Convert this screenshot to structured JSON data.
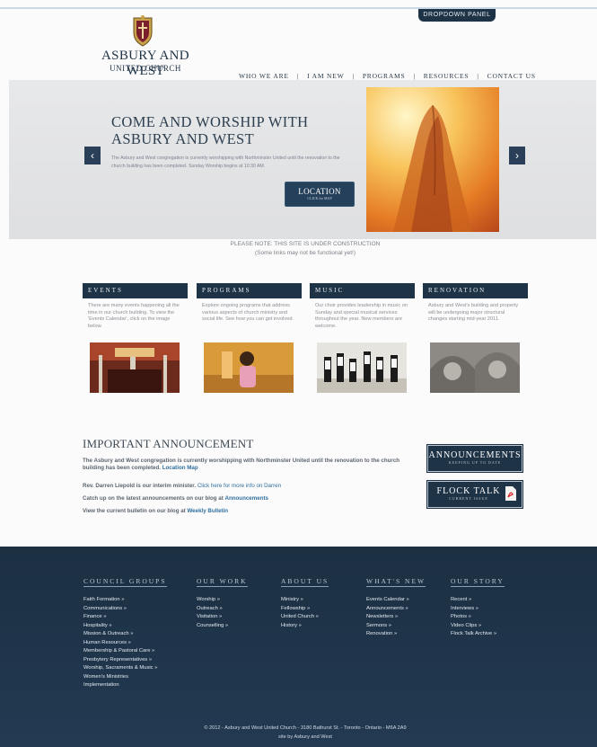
{
  "header": {
    "dropdown_label": "DROPDOWN PANEL",
    "logo_title": "ASBURY AND WEST",
    "logo_subtitle": "UNITED CHURCH"
  },
  "nav": [
    {
      "label": "WHO WE ARE"
    },
    {
      "label": "I AM NEW"
    },
    {
      "label": "PROGRAMS"
    },
    {
      "label": "RESOURCES"
    },
    {
      "label": "CONTACT US"
    }
  ],
  "hero": {
    "title_line1": "COME AND WORSHIP WITH",
    "title_line2": "ASBURY AND WEST",
    "text": "The Asbury and West congregation is currently worshipping with Northminster United until the renovation to the church building has been completed. Sunday Worship begins at 10:30 AM.",
    "button_label": "LOCATION",
    "button_sub": "CLICK for MAP",
    "prev_icon": "‹",
    "next_icon": "›"
  },
  "notice": {
    "line1": "PLEASE NOTE: THIS SITE IS UNDER CONSTRUCTION",
    "line2": "(Some links may not be functional yet!)"
  },
  "cards": [
    {
      "title": "EVENTS",
      "text": "There are many events happening all the time in our church building. To view the 'Events Calendar', click on the image below."
    },
    {
      "title": "PROGRAMS",
      "text": "Explore ongoing programs that address various aspects of church ministry and social life. See how you can get involved."
    },
    {
      "title": "MUSIC",
      "text": "Our choir provides leadership in music on Sunday and special musical services throughout the year. New members are welcome."
    },
    {
      "title": "RENOVATION",
      "text": "Asbury and West's building and property will be undergoing major structural changes starting mid-year 2011."
    }
  ],
  "announcement": {
    "title": "IMPORTANT ANNOUNCEMENT",
    "p1": "The Asbury and West congregation is currently worshipping with Northminster United until the renovation to the church building has been completed.",
    "p1_link": "Location Map",
    "p2": "Rev. Darren Liepold is our interim minister.",
    "p2_link": "Click here for more info on Darren",
    "p3": "Catch up on the latest announcements on our blog at",
    "p3_link": "Announcements",
    "p4": "View the current bulletin on our blog at",
    "p4_link": "Weekly Bulletin"
  },
  "side_buttons": {
    "announcements_title": "ANNOUNCEMENTS",
    "announcements_sub": "KEEPING UP TO DATE",
    "flock_title": "FLOCK TALK",
    "flock_sub": "CURRENT ISSUE"
  },
  "footer": {
    "columns": [
      {
        "heading": "COUNCIL GROUPS",
        "items": [
          "Faith Formation »",
          "Communications »",
          "Finance »",
          "Hospitality »",
          "Mission & Outreach »",
          "Human Resources »",
          "Membership & Pastoral Care »",
          "Presbytery Representatives »",
          "Worship, Sacraments & Music »",
          "Women's Ministries",
          "Implementation"
        ]
      },
      {
        "heading": "OUR WORK",
        "items": [
          "Worship »",
          "Outreach »",
          "Visitation »",
          "Counselling »"
        ]
      },
      {
        "heading": "ABOUT US",
        "items": [
          "Ministry »",
          "Fellowship »",
          "United Church »",
          "History »"
        ]
      },
      {
        "heading": "WHAT'S NEW",
        "items": [
          "Events Calendar »",
          "Announcements »",
          "Newsletters »",
          "Sermons »",
          "Renovation »"
        ]
      },
      {
        "heading": "OUR STORY",
        "items": [
          "Recent »",
          "Interviews »",
          "Photos »",
          "Video Clips »",
          "Flock Talk Archive »"
        ]
      }
    ],
    "copyright": "© 2012 - Asbury and West United Church - 3180 Bathurst St. - Toronto - Ontario - M6A 2A9",
    "credit": "site by Asbury and West"
  },
  "colors": {
    "navy": "#1f3347",
    "link": "#2f6f9f",
    "hero_bg": "#e2e3e5"
  }
}
